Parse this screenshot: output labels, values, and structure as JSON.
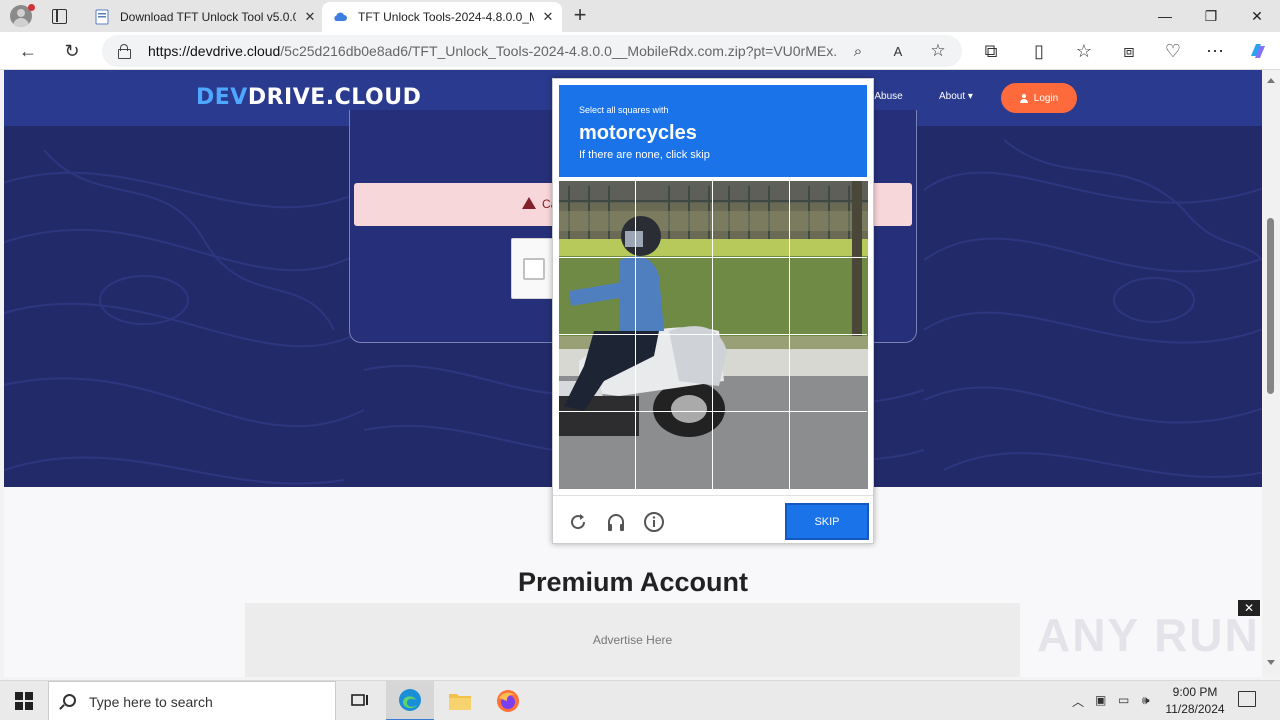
{
  "browser": {
    "tabs": [
      {
        "title": "Download TFT Unlock Tool v5.0.0",
        "active": false
      },
      {
        "title": "TFT Unlock Tools-2024-4.8.0.0_M",
        "active": true
      }
    ],
    "url_domain": "https://devdrive.cloud",
    "url_path": "/5c25d216db0e8ad6/TFT_Unlock_Tools-2024-4.8.0.0__MobileRdx.com.zip?pt=VU0rMEx...",
    "colors": {
      "accent": "#1a73e8",
      "chrome": "#e5e5e5"
    }
  },
  "site": {
    "logo_a": "DEV",
    "logo_b": "DRIVE.CLOUD",
    "nav": {
      "report": "rt Abuse",
      "about": "About ▾"
    },
    "login_label": "Login",
    "alert_text": "Ca",
    "premium_title": "Premium Account",
    "ad_text": "Advertise Here",
    "ad_close": "✕",
    "colors": {
      "hero": "#232a6a",
      "navbar": "#2a3a8f",
      "login": "#ff6a3d",
      "alert": "#f8d7da"
    }
  },
  "challenge": {
    "prompt": "Select all squares with",
    "object": "motorcycles",
    "hint": "If there are none, click skip",
    "skip_label": "SKIP",
    "icons": [
      "refresh-icon",
      "headphones-icon",
      "info-icon"
    ]
  },
  "watermark": "ANY RUN",
  "taskbar": {
    "search_placeholder": "Type here to search",
    "time": "9:00 PM",
    "date": "11/28/2024"
  }
}
